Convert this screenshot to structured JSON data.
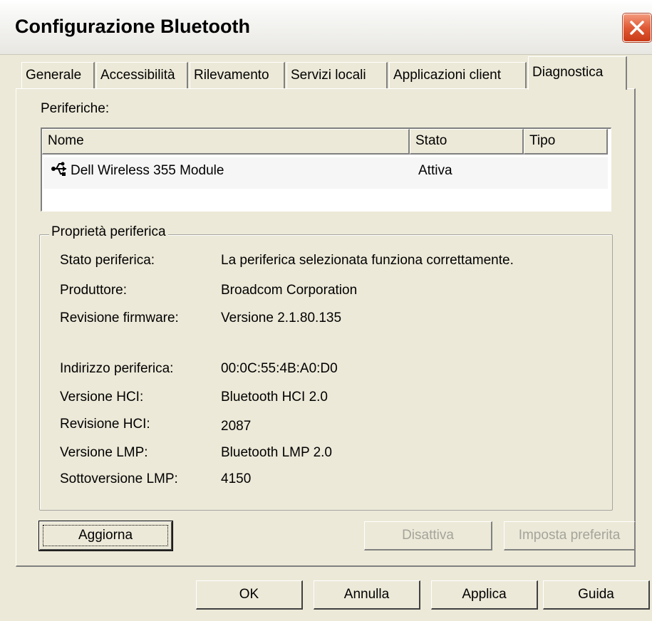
{
  "window": {
    "title": "Configurazione Bluetooth"
  },
  "tabs": [
    {
      "label": "Generale"
    },
    {
      "label": "Accessibilità"
    },
    {
      "label": "Rilevamento"
    },
    {
      "label": "Servizi locali"
    },
    {
      "label": "Applicazioni client"
    },
    {
      "label": "Diagnostica",
      "active": true
    }
  ],
  "devices": {
    "label": "Periferiche:",
    "columns": [
      "Nome",
      "Stato",
      "Tipo"
    ],
    "rows": [
      {
        "name": "Dell Wireless 355 Module",
        "state": "Attiva",
        "type": "",
        "icon": "usb-icon"
      }
    ]
  },
  "properties": {
    "group_label": "Proprietà periferica",
    "items": [
      {
        "label": "Stato periferica:",
        "value": "La periferica selezionata funziona correttamente."
      },
      {
        "label": "Produttore:",
        "value": "Broadcom Corporation"
      },
      {
        "label": "Revisione firmware:",
        "value": "Versione 2.1.80.135"
      },
      {
        "label": "Indirizzo periferica:",
        "value": "00:0C:55:4B:A0:D0"
      },
      {
        "label": "Versione HCI:",
        "value": "Bluetooth HCI 2.0"
      },
      {
        "label": "Revisione HCI:",
        "value": "2087"
      },
      {
        "label": "Versione LMP:",
        "value": "Bluetooth LMP 2.0"
      },
      {
        "label": "Sottoversione LMP:",
        "value": "4150"
      }
    ]
  },
  "panel_buttons": {
    "refresh": "Aggiorna",
    "disable": "Disattiva",
    "set_preferred": "Imposta preferita"
  },
  "dialog_buttons": {
    "ok": "OK",
    "cancel": "Annulla",
    "apply": "Applica",
    "help": "Guida"
  },
  "icons": {
    "close": "close-icon",
    "device": "usb-icon"
  },
  "colors": {
    "window_bg": "#ece9d8",
    "close_button": "#e05a36",
    "disabled_text": "#a4a49a"
  }
}
